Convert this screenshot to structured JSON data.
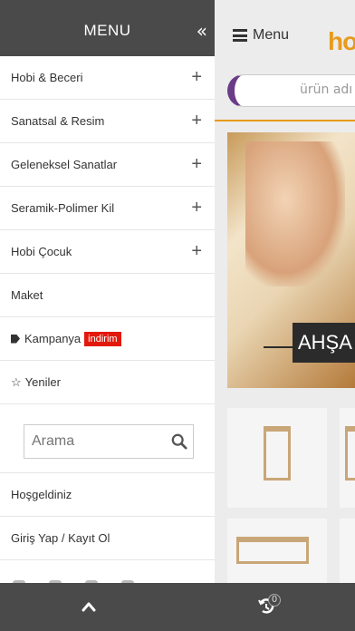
{
  "side_menu": {
    "title": "MENU",
    "collapse_icon": "double-chevron-left-icon",
    "items": [
      {
        "label": "Hobi & Beceri",
        "expandable": true
      },
      {
        "label": "Sanatsal & Resim",
        "expandable": true
      },
      {
        "label": "Geleneksel Sanatlar",
        "expandable": true
      },
      {
        "label": "Seramik-Polimer Kil",
        "expandable": true
      },
      {
        "label": "Hobi Çocuk",
        "expandable": true
      },
      {
        "label": "Maket",
        "expandable": false
      },
      {
        "label": "Kampanya",
        "icon": "tag-icon",
        "badge": "indirim"
      },
      {
        "label": "Yeniler",
        "icon": "star-icon"
      }
    ],
    "search": {
      "placeholder": "Arama"
    },
    "links": [
      {
        "label": "Hoşgeldiniz"
      },
      {
        "label": "Giriş Yap / Kayıt Ol"
      }
    ]
  },
  "page": {
    "menu_label": "Menu",
    "logo": "ho",
    "search_placeholder": "ürün adı v",
    "banner_label": "AHŞA"
  },
  "bottom_bar": {
    "up_icon": "chevron-up-icon",
    "history_icon": "history-icon",
    "history_count": "0"
  },
  "colors": {
    "header_bg": "#4a4a4a",
    "accent_orange": "#e89a1c",
    "badge_red": "#e3180d",
    "search_purple": "#6a3c88"
  }
}
